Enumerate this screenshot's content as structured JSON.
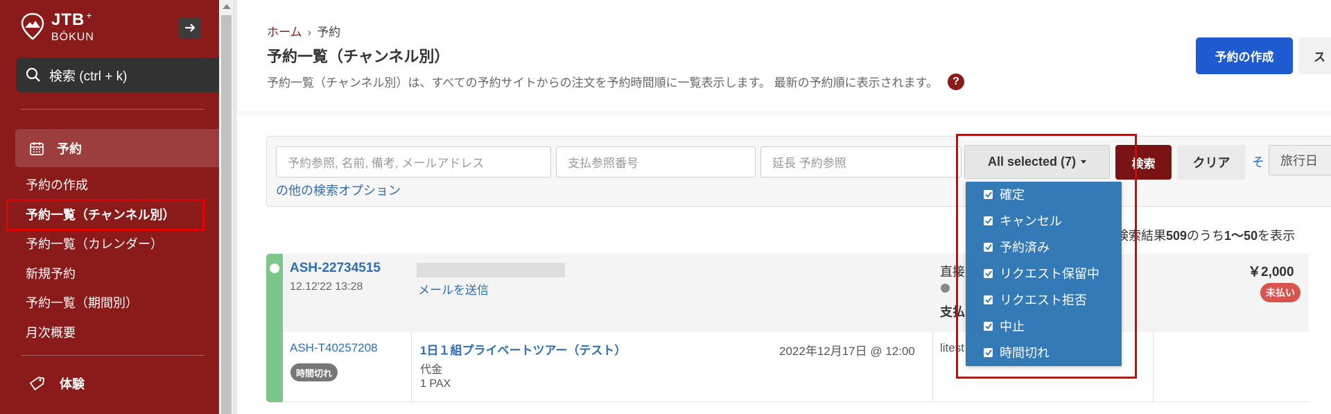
{
  "sidebar": {
    "logo_text": "JTB",
    "logo_sup": "+",
    "logo_sub": "BÓKUN",
    "search_label": "検索 (ctrl + k)",
    "main_item": "予約",
    "sub_items": [
      "予約の作成",
      "予約一覧（チャンネル別）",
      "予約一覧（カレンダー）",
      "新規予約",
      "予約一覧（期間別）",
      "月次概要"
    ],
    "experience_item": "体験"
  },
  "header": {
    "breadcrumb_home": "ホーム",
    "breadcrumb_sep": "›",
    "breadcrumb_current": "予約",
    "title": "予約一覧（チャンネル別）",
    "description": "予約一覧（チャンネル別）は、すべての予約サイトからの注文を予約時間順に一覧表示します。 最新の予約順に表示されます。",
    "help_icon": "?",
    "create_button": "予約の作成",
    "other_button": "ス"
  },
  "search": {
    "input1_placeholder": "予約参照, 名前, 備考, メールアドレス",
    "input2_placeholder": "支払参照番号",
    "input3_placeholder": "延長 予約参照",
    "status_button": "All selected (7)",
    "search_button": "検索",
    "clear_button": "クリア",
    "more_options_a": "そ",
    "more_options_b": "の他の検索オプション",
    "date_select": "旅行日"
  },
  "status_dropdown": {
    "options": [
      "確定",
      "キャンセル",
      "予約済み",
      "リクエスト保留中",
      "リクエスト拒否",
      "中止",
      "時間切れ"
    ]
  },
  "results": {
    "prefix": "検索結果",
    "total": "509",
    "mid": "のうち",
    "range": "1〜50",
    "suffix": "を表示"
  },
  "booking": {
    "ref": "ASH-22734515",
    "datetime": "12.12'22 13:28",
    "send_mail": "メールを送信",
    "channel_label": "直接",
    "payment_label": "支払",
    "price": "￥2,000",
    "unpaid_badge": "未払い",
    "product_ref": "ASH-T40257208",
    "expired_badge": "時間切れ",
    "product_name": "1日１組プライベートツアー（テスト）",
    "rate": "代金",
    "pax": "1 PAX",
    "product_datetime": "2022年12月17日 @ 12:00",
    "product_channel": "litest"
  },
  "colors": {
    "sidebar_bg": "#8b1a1a",
    "primary_blue": "#1f5bd0",
    "dropdown_bg": "#337ab7",
    "search_btn": "#7a1414",
    "confirmed_stripe": "#7cc68a",
    "unpaid_badge": "#d9534f",
    "highlight_red": "#e50000"
  }
}
